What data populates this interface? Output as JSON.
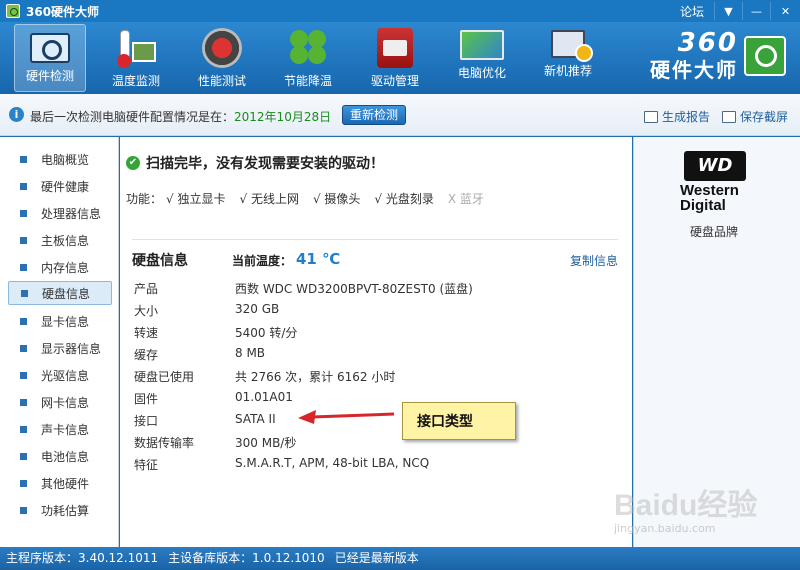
{
  "app": {
    "title": "360硬件大师",
    "forum": "论坛"
  },
  "toolbar": {
    "tabs": [
      {
        "label": "硬件检测"
      },
      {
        "label": "温度监测"
      },
      {
        "label": "性能测试"
      },
      {
        "label": "节能降温"
      },
      {
        "label": "驱动管理"
      },
      {
        "label": "电脑优化"
      },
      {
        "label": "新机推荐"
      }
    ],
    "brand_number": "360",
    "brand_name": "硬件大师"
  },
  "infobar": {
    "message": "最后一次检测电脑硬件配置情况是在：",
    "date": "2012年10月28日",
    "recheck": "重新检测",
    "report": "生成报告",
    "screenshot": "保存截屏"
  },
  "sidebar": {
    "items": [
      {
        "label": "电脑概览"
      },
      {
        "label": "硬件健康"
      },
      {
        "label": "处理器信息"
      },
      {
        "label": "主板信息"
      },
      {
        "label": "内存信息"
      },
      {
        "label": "硬盘信息"
      },
      {
        "label": "显卡信息"
      },
      {
        "label": "显示器信息"
      },
      {
        "label": "光驱信息"
      },
      {
        "label": "网卡信息"
      },
      {
        "label": "声卡信息"
      },
      {
        "label": "电池信息"
      },
      {
        "label": "其他硬件"
      },
      {
        "label": "功耗估算"
      }
    ],
    "active": "硬盘信息"
  },
  "main": {
    "scan_result": "扫描完毕，没有发现需要安装的驱动！",
    "features_label": "功能：",
    "features": [
      {
        "label": "√ 独立显卡"
      },
      {
        "label": "√ 无线上网"
      },
      {
        "label": "√ 摄像头"
      },
      {
        "label": "√ 光盘刻录"
      },
      {
        "label": "X 蓝牙"
      }
    ],
    "disk_title": "硬盘信息",
    "temp_label": "当前温度：",
    "temp_value": "41 ℃",
    "copy": "复制信息",
    "rows": [
      {
        "k": "产品",
        "v": "西数 WDC WD3200BPVT-80ZEST0 (蓝盘)"
      },
      {
        "k": "大小",
        "v": "320 GB"
      },
      {
        "k": "转速",
        "v": "5400 转/分"
      },
      {
        "k": "缓存",
        "v": "8 MB"
      },
      {
        "k": "硬盘已使用",
        "v": "共 2766 次，累计 6162 小时"
      },
      {
        "k": "固件",
        "v": "01.01A01"
      },
      {
        "k": "接口",
        "v": "SATA II"
      },
      {
        "k": "数据传输率",
        "v": "300 MB/秒"
      },
      {
        "k": "特征",
        "v": "S.M.A.R.T,  APM,  48-bit LBA,  NCQ"
      }
    ],
    "callout": "接口类型"
  },
  "right_panel": {
    "logo_mark": "WD",
    "logo_text": "Western Digital",
    "caption": "硬盘品牌"
  },
  "watermark": {
    "text": "Baidu经验",
    "url": "jingyan.baidu.com"
  },
  "statusbar": {
    "main_version": "主程序版本：3.40.12.1011",
    "db_version": "主设备库版本：1.0.12.1010",
    "latest": "已经是最新版本"
  },
  "colors": {
    "accent": "#1a78c2",
    "date": "#1c8a1c",
    "temp": "#1f7fcf",
    "callout_bg": "#fff3a6",
    "arrow": "#d8252b"
  }
}
